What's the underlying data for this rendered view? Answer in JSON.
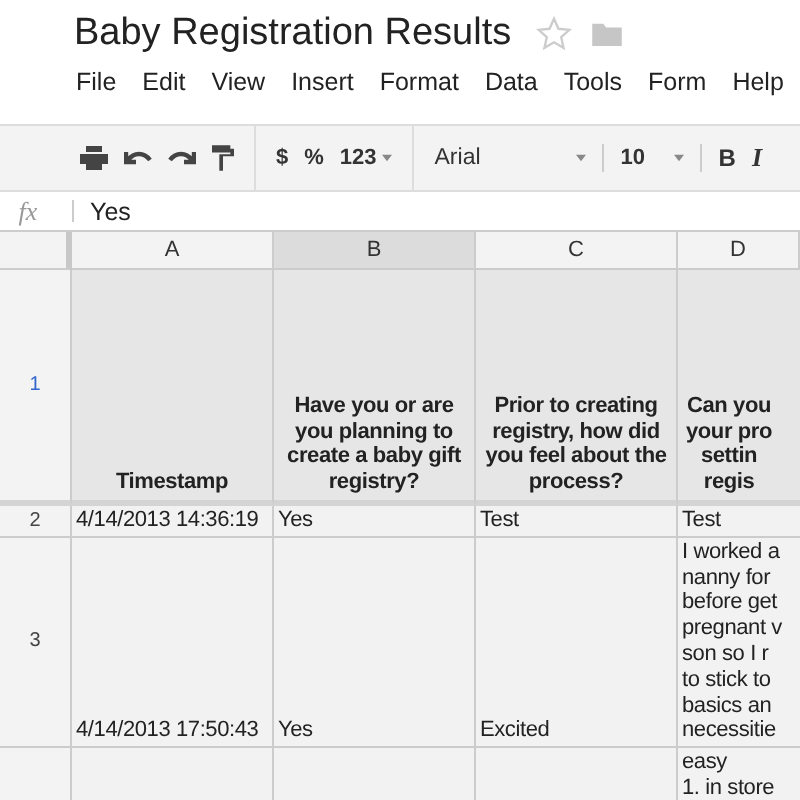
{
  "document": {
    "title": "Baby Registration Results",
    "starred": false
  },
  "menu": [
    "File",
    "Edit",
    "View",
    "Insert",
    "Format",
    "Data",
    "Tools",
    "Form",
    "Help"
  ],
  "toolbar": {
    "currency": "$",
    "percent": "%",
    "number_format": "123",
    "font": "Arial",
    "font_size": "10",
    "bold": "B",
    "italic": "I"
  },
  "formula_bar": {
    "label": "fx",
    "value": "Yes"
  },
  "columns": [
    {
      "label": "A",
      "selected": false
    },
    {
      "label": "B",
      "selected": true
    },
    {
      "label": "C",
      "selected": false
    },
    {
      "label": "D",
      "selected": false
    }
  ],
  "rows": [
    {
      "number": "1",
      "kind": "header",
      "cells": [
        [
          "Timestamp"
        ],
        [
          "Have you or are",
          "you planning to",
          "create a baby gift",
          "registry?"
        ],
        [
          "Prior to creating",
          "registry, how did",
          "you feel about the",
          "process?"
        ],
        [
          "Can you",
          "your pro",
          "settin",
          "regis"
        ]
      ]
    },
    {
      "number": "2",
      "kind": "data",
      "cells": [
        [
          "4/14/2013 14:36:19"
        ],
        [
          "Yes"
        ],
        [
          "Test"
        ],
        [
          "Test"
        ]
      ]
    },
    {
      "number": "3",
      "kind": "data",
      "cells": [
        [
          "4/14/2013 17:50:43"
        ],
        [
          "Yes"
        ],
        [
          "Excited"
        ],
        [
          "I worked a",
          "nanny for",
          "before get",
          "pregnant v",
          "son so I r",
          "to stick to",
          "basics an",
          "necessitie"
        ]
      ]
    },
    {
      "number": "",
      "kind": "top",
      "cells": [
        [],
        [],
        [],
        [
          "easy",
          "1. in store"
        ]
      ]
    }
  ]
}
